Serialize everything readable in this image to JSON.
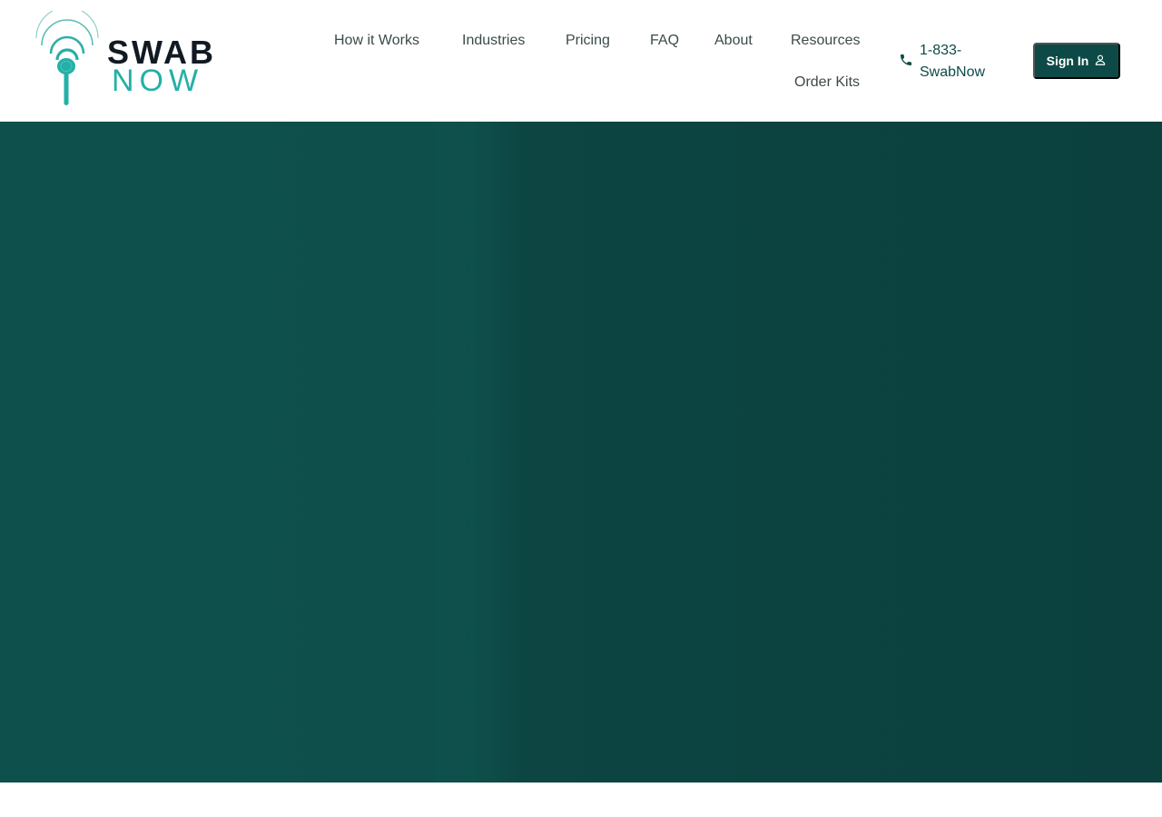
{
  "brand": {
    "line1": "SWAB",
    "line2": "NOW",
    "primary_color": "#0d4a47",
    "accent_color": "#24b0a7"
  },
  "nav": {
    "items": [
      {
        "label": "How it Works"
      },
      {
        "label": "Industries"
      },
      {
        "label": "Pricing"
      },
      {
        "label": "FAQ"
      },
      {
        "label": "About"
      },
      {
        "label": "Resources"
      },
      {
        "label": "Order Kits"
      }
    ]
  },
  "contact": {
    "phone": "1-833-SwabNow",
    "icon": "phone-icon"
  },
  "auth": {
    "signin_label": "Sign In",
    "icon": "user-icon"
  },
  "hero": {
    "background_color": "#0e4f4b"
  }
}
